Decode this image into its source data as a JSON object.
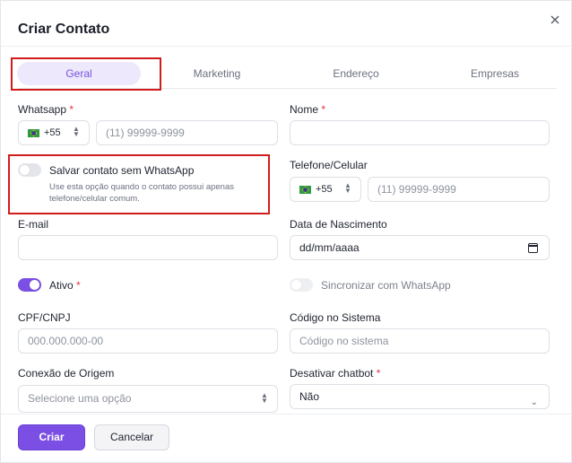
{
  "dialog": {
    "title": "Criar Contato",
    "close_icon": "close-icon"
  },
  "tabs": [
    {
      "label": "Geral",
      "active": true
    },
    {
      "label": "Marketing",
      "active": false
    },
    {
      "label": "Endereço",
      "active": false
    },
    {
      "label": "Empresas",
      "active": false
    }
  ],
  "form": {
    "whatsapp": {
      "label": "Whatsapp",
      "required": "*",
      "country_code": "+55",
      "flag": "brazil-flag-icon",
      "placeholder": "(11) 99999-9999"
    },
    "nome": {
      "label": "Nome",
      "required": "*",
      "value": ""
    },
    "salvar_sem_whatsapp": {
      "label": "Salvar contato sem WhatsApp",
      "hint_line1": "Use esta opção quando o contato possui apenas",
      "hint_line2": "telefone/celular comum.",
      "checked": false
    },
    "telefone": {
      "label": "Telefone/Celular",
      "country_code": "+55",
      "flag": "brazil-flag-icon",
      "placeholder": "(11) 99999-9999"
    },
    "email": {
      "label": "E-mail",
      "value": ""
    },
    "nascimento": {
      "label": "Data de Nascimento",
      "placeholder": "dd/mm/aaaa"
    },
    "ativo": {
      "label": "Ativo",
      "required": "*",
      "checked": true
    },
    "sincronizar": {
      "label": "Sincronizar com WhatsApp",
      "checked": false
    },
    "cpf": {
      "label": "CPF/CNPJ",
      "placeholder": "000.000.000-00"
    },
    "codigo": {
      "label": "Código no Sistema",
      "placeholder": "Código no sistema"
    },
    "conexao": {
      "label": "Conexão de Origem",
      "placeholder": "Selecione uma opção"
    },
    "chatbot": {
      "label": "Desativar chatbot",
      "required": "*",
      "value": "Não"
    }
  },
  "footer": {
    "create_label": "Criar",
    "cancel_label": "Cancelar"
  },
  "colors": {
    "accent": "#7b4fe3",
    "highlight_border": "#d21c1c",
    "required": "#e0344c"
  }
}
